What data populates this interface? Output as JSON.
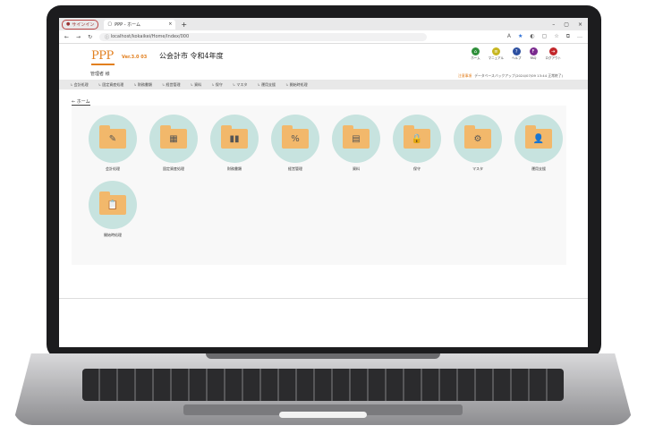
{
  "browser": {
    "signin_label": "サインイン",
    "tab_title": "PPP - ホーム",
    "url": "localhost/kokaikei/Home/Index/000"
  },
  "header": {
    "logo": "PPP",
    "version": "Ver.3.0 03",
    "org": "公会計市 令和4年度",
    "user": "管理者 様",
    "status_warn": "注意事項",
    "status_text": "データベースバックアップ(2024/07/09 13:44 正常終了)",
    "icons": [
      {
        "label": "ホーム",
        "color": "#2f8f3a",
        "glyph": "⌂"
      },
      {
        "label": "マニュアル",
        "color": "#c7b620",
        "glyph": "≡"
      },
      {
        "label": "ヘルプ",
        "color": "#2c4fa0",
        "glyph": "?"
      },
      {
        "label": "FAQ",
        "color": "#7a2a8e",
        "glyph": "F"
      },
      {
        "label": "ログアウト",
        "color": "#c2262a",
        "glyph": "⇥"
      }
    ]
  },
  "menu": [
    "会計処理",
    "固定資産処理",
    "財務書類",
    "経営管理",
    "資料",
    "保守",
    "マスタ",
    "運用支援",
    "開始時処理"
  ],
  "home_link": "← ホーム",
  "tiles": [
    {
      "label": "会計処理",
      "glyph": "✎"
    },
    {
      "label": "固定資産処理",
      "glyph": "▦"
    },
    {
      "label": "財務書類",
      "glyph": "▮▮"
    },
    {
      "label": "経営管理",
      "glyph": "%"
    },
    {
      "label": "資料",
      "glyph": "▤"
    },
    {
      "label": "保守",
      "glyph": "🔒"
    },
    {
      "label": "マスタ",
      "glyph": "⚙"
    },
    {
      "label": "運用支援",
      "glyph": "👤"
    },
    {
      "label": "開始時処理",
      "glyph": "📋"
    }
  ]
}
